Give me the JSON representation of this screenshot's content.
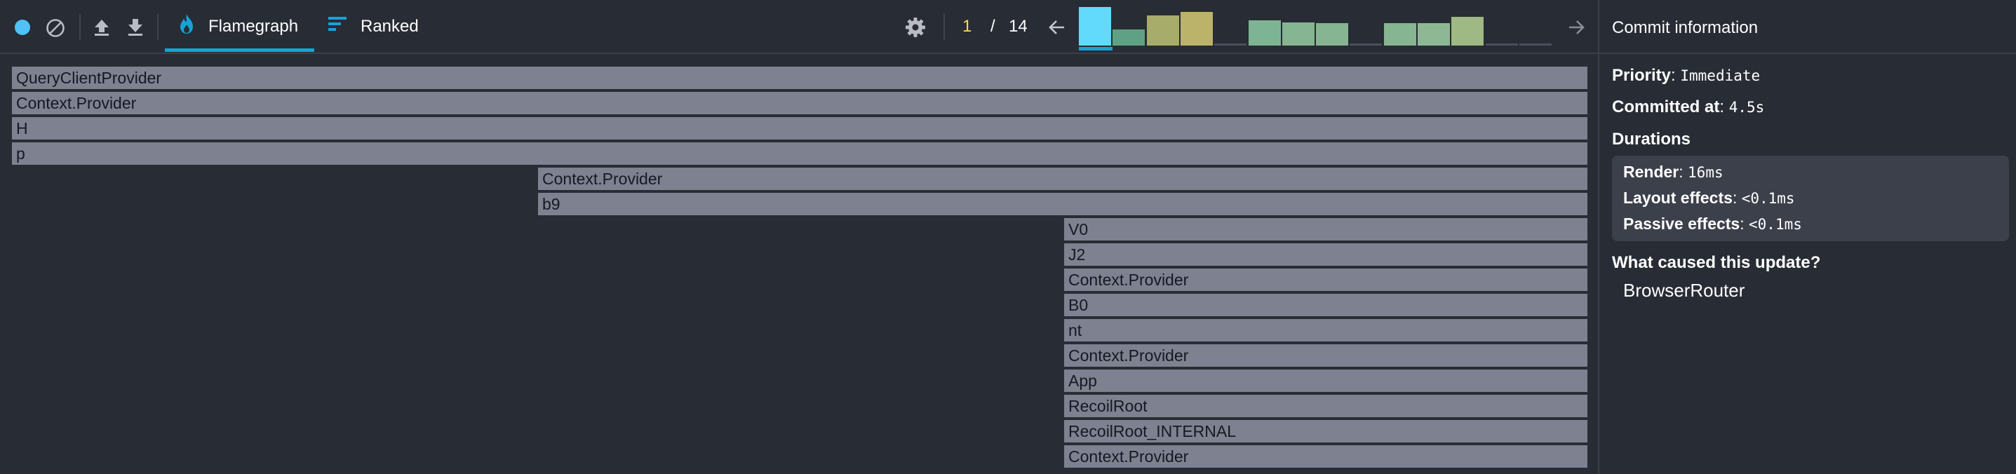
{
  "toolbar": {
    "tabs": [
      {
        "label": "Flamegraph",
        "active": true
      },
      {
        "label": "Ranked",
        "active": false
      }
    ],
    "commit_nav": {
      "current": "1",
      "separator": "/",
      "total": "14"
    },
    "commit_bars": [
      {
        "height": 1.0,
        "color": "#61dafb",
        "selected": true
      },
      {
        "height": 0.42,
        "color": "#5fa184"
      },
      {
        "height": 0.78,
        "color": "#a8ac6a"
      },
      {
        "height": 0.88,
        "color": "#bcb36a"
      },
      {
        "height": 0.05,
        "color": "#4a4f5c"
      },
      {
        "height": 0.65,
        "color": "#7db594"
      },
      {
        "height": 0.6,
        "color": "#86b591"
      },
      {
        "height": 0.58,
        "color": "#86b591"
      },
      {
        "height": 0.05,
        "color": "#4a4f5c"
      },
      {
        "height": 0.58,
        "color": "#86b591"
      },
      {
        "height": 0.58,
        "color": "#8db893"
      },
      {
        "height": 0.75,
        "color": "#9eb983"
      },
      {
        "height": 0.05,
        "color": "#4a4f5c"
      },
      {
        "height": 0.05,
        "color": "#4a4f5c"
      }
    ],
    "icons": [
      "record-icon",
      "clear-icon",
      "upload-icon",
      "download-icon",
      "flame-icon",
      "ranked-icon",
      "settings-icon",
      "arrow-left-icon",
      "arrow-right-icon"
    ],
    "colors": {
      "accent": "#17a2d6",
      "record": "#4fc3f7",
      "current_commit": "#ffd94a"
    }
  },
  "flamegraph": {
    "frames": [
      {
        "label": "QueryClientProvider",
        "start": 0.0,
        "end": 1.0
      },
      {
        "label": "Context.Provider",
        "start": 0.0,
        "end": 1.0
      },
      {
        "label": "H",
        "start": 0.0,
        "end": 1.0
      },
      {
        "label": "p",
        "start": 0.0,
        "end": 1.0
      },
      {
        "label": "Context.Provider",
        "start": 0.3336,
        "end": 1.0
      },
      {
        "label": "b9",
        "start": 0.3336,
        "end": 1.0
      },
      {
        "label": "V0",
        "start": 0.6672,
        "end": 1.0
      },
      {
        "label": "J2",
        "start": 0.6672,
        "end": 1.0
      },
      {
        "label": "Context.Provider",
        "start": 0.6672,
        "end": 1.0
      },
      {
        "label": "B0",
        "start": 0.6672,
        "end": 1.0
      },
      {
        "label": "nt",
        "start": 0.6672,
        "end": 1.0
      },
      {
        "label": "Context.Provider",
        "start": 0.6672,
        "end": 1.0
      },
      {
        "label": "App",
        "start": 0.6672,
        "end": 1.0
      },
      {
        "label": "RecoilRoot",
        "start": 0.6672,
        "end": 1.0
      },
      {
        "label": "RecoilRoot_INTERNAL",
        "start": 0.6672,
        "end": 1.0
      },
      {
        "label": "Context.Provider",
        "start": 0.6672,
        "end": 1.0
      }
    ],
    "frame_color": "#7d8190"
  },
  "side_panel": {
    "title": "Commit information",
    "priority_label": "Priority",
    "priority_value": "Immediate",
    "committed_label": "Committed at",
    "committed_value": "4.5s",
    "durations_label": "Durations",
    "render_label": "Render",
    "render_value": "16ms",
    "layout_label": "Layout effects",
    "layout_value": "<0.1ms",
    "passive_label": "Passive effects",
    "passive_value": "<0.1ms",
    "cause_label": "What caused this update?",
    "cause_value": "BrowserRouter"
  }
}
